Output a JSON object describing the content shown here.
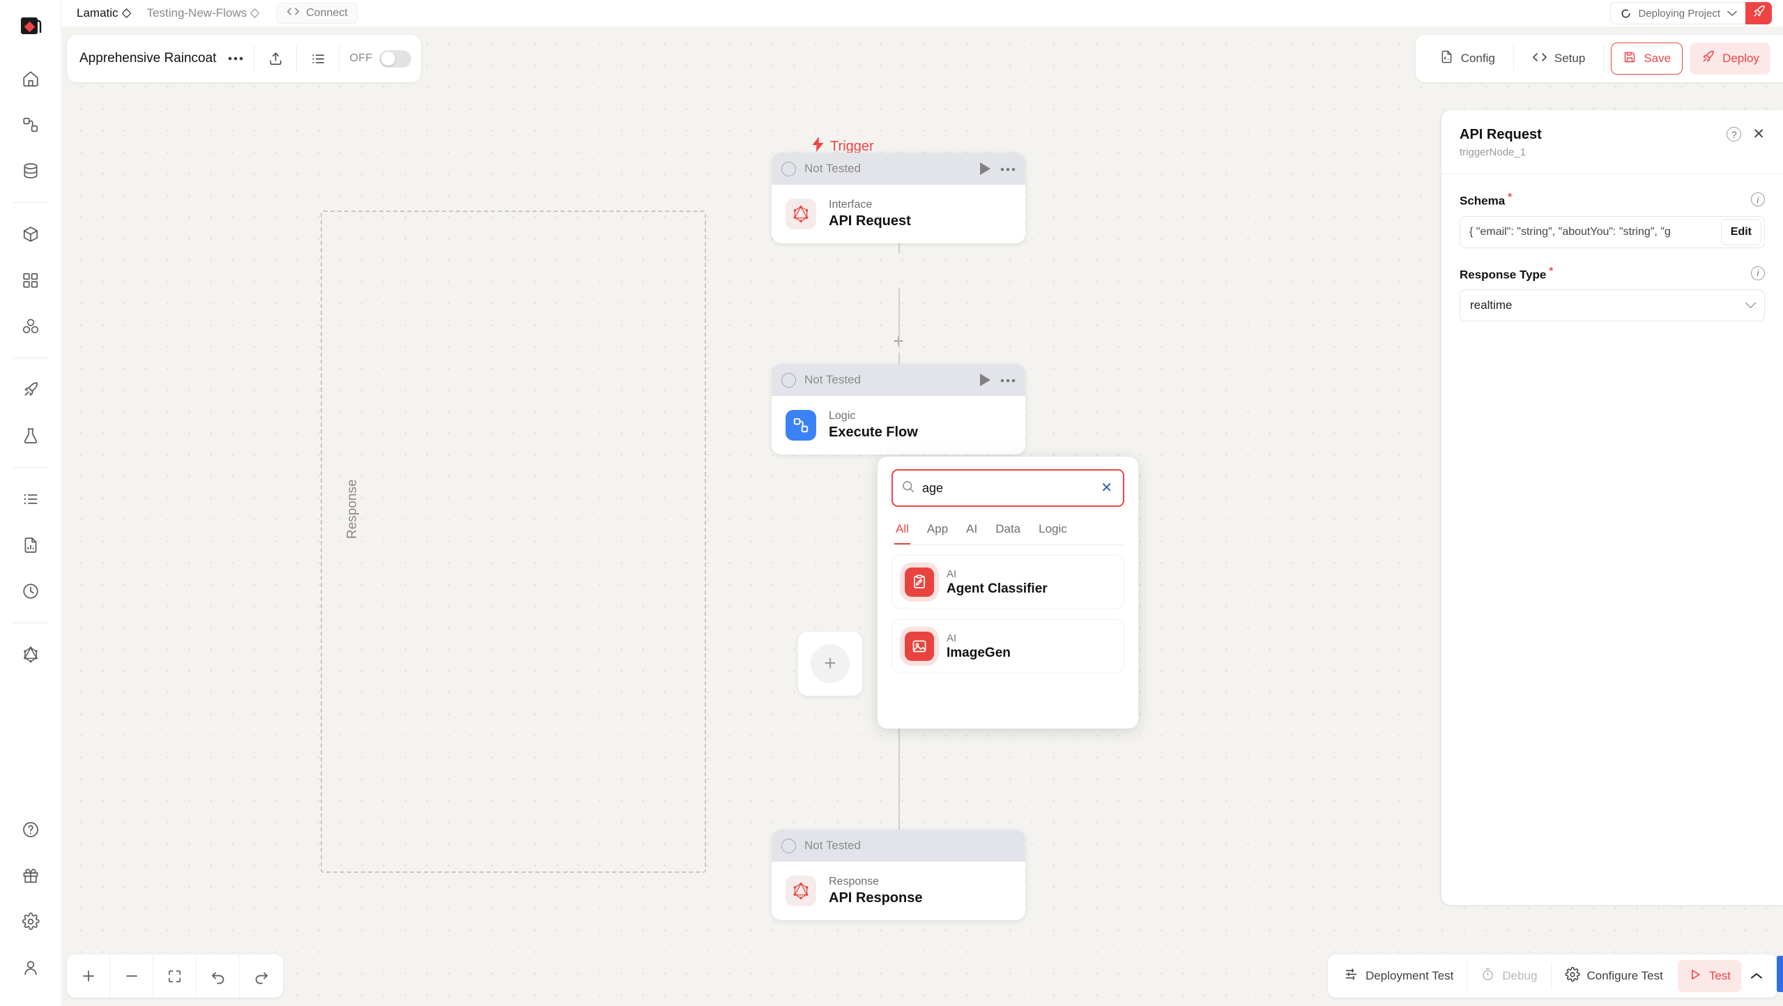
{
  "topbar": {
    "org": "Lamatic",
    "project": "Testing-New-Flows",
    "connect_label": "Connect",
    "deploy_status": "Deploying Project",
    "rocket_icon": "rocket-icon",
    "spinner_icon": "loading-spinner-icon"
  },
  "flowbar": {
    "title": "Apprehensive Raincoat",
    "more_icon": "ellipsis-icon",
    "share_icon": "upload-icon",
    "list_icon": "list-icon",
    "toggle_label": "OFF"
  },
  "flow_actions": {
    "config_label": "Config",
    "setup_label": "Setup",
    "save_label": "Save",
    "deploy_label": "Deploy"
  },
  "sidebar": {
    "logo": "lamatic-logo",
    "groups": [
      {
        "items": [
          {
            "name": "home-icon",
            "label": "Home"
          },
          {
            "name": "flows-icon",
            "label": "Flows"
          },
          {
            "name": "database-icon",
            "label": "Data"
          }
        ]
      },
      {
        "items": [
          {
            "name": "cube-icon",
            "label": "Models"
          },
          {
            "name": "apps-grid-icon",
            "label": "Apps"
          },
          {
            "name": "blocks-icon",
            "label": "Integrations"
          }
        ]
      },
      {
        "items": [
          {
            "name": "rocket-icon",
            "label": "Deployments"
          },
          {
            "name": "flask-icon",
            "label": "Experiments"
          }
        ]
      },
      {
        "items": [
          {
            "name": "list-icon",
            "label": "Logs"
          },
          {
            "name": "report-icon",
            "label": "Reports"
          },
          {
            "name": "clock-icon",
            "label": "History"
          }
        ]
      },
      {
        "items": [
          {
            "name": "graphql-icon",
            "label": "GraphQL"
          }
        ]
      }
    ],
    "bottom_items": [
      {
        "name": "help-circle-icon",
        "label": "Help"
      },
      {
        "name": "gift-icon",
        "label": "What's New"
      },
      {
        "name": "gear-icon",
        "label": "Settings"
      },
      {
        "name": "user-icon",
        "label": "Account"
      }
    ]
  },
  "canvas": {
    "trigger_label": "Trigger",
    "trigger_icon": "lightning-bolt-icon",
    "response_group_label": "Response",
    "add_node_icon": "plus-icon",
    "nodes": [
      {
        "status": "Not Tested",
        "type": "Interface",
        "name": "API Request",
        "icon": "graphql-icon"
      },
      {
        "status": "Not Tested",
        "type": "Logic",
        "name": "Execute Flow",
        "icon": "execute-flow-icon"
      },
      {
        "status": "Not Tested",
        "type": "Response",
        "name": "API Response",
        "icon": "graphql-icon"
      }
    ]
  },
  "node_picker": {
    "search_value": "age",
    "search_placeholder": "Search",
    "search_icon": "search-icon",
    "clear_icon": "clear-x-icon",
    "tabs": [
      {
        "label": "All",
        "active": true
      },
      {
        "label": "App",
        "active": false
      },
      {
        "label": "AI",
        "active": false
      },
      {
        "label": "Data",
        "active": false
      },
      {
        "label": "Logic",
        "active": false
      }
    ],
    "results": [
      {
        "category": "AI",
        "name": "Agent Classifier",
        "icon": "classifier-icon"
      },
      {
        "category": "AI",
        "name": "ImageGen",
        "icon": "image-icon"
      }
    ]
  },
  "right_panel": {
    "title": "API Request",
    "subtitle": "triggerNode_1",
    "help_icon": "question-circle-icon",
    "close_icon": "close-icon",
    "schema": {
      "label": "Schema",
      "required_mark": "*",
      "value": "{ \"email\": \"string\", \"aboutYou\": \"string\", \"g",
      "edit_label": "Edit",
      "info_icon": "info-icon"
    },
    "response_type": {
      "label": "Response Type",
      "required_mark": "*",
      "value": "realtime",
      "info_icon": "info-icon",
      "chevron_icon": "chevron-down-icon"
    }
  },
  "zoom_controls": [
    {
      "name": "zoom-in-icon",
      "label": "Zoom in"
    },
    {
      "name": "zoom-out-icon",
      "label": "Zoom out"
    },
    {
      "name": "fit-view-icon",
      "label": "Fit view"
    },
    {
      "name": "undo-icon",
      "label": "Undo"
    },
    {
      "name": "redo-icon",
      "label": "Redo"
    }
  ],
  "test_bar": {
    "deployment_test_label": "Deployment Test",
    "debug_label": "Debug",
    "configure_test_label": "Configure Test",
    "test_label": "Test",
    "sliders_icon": "sliders-icon",
    "stopwatch_icon": "stopwatch-icon",
    "gear_icon": "gear-icon",
    "play_icon": "play-icon",
    "caret_icon": "chevron-up-icon"
  },
  "colors": {
    "accent_red": "#ef4444",
    "canvas_bg": "#f4f3f0",
    "node_header": "#e2e4ea",
    "logic_blue": "#3b82f6"
  }
}
